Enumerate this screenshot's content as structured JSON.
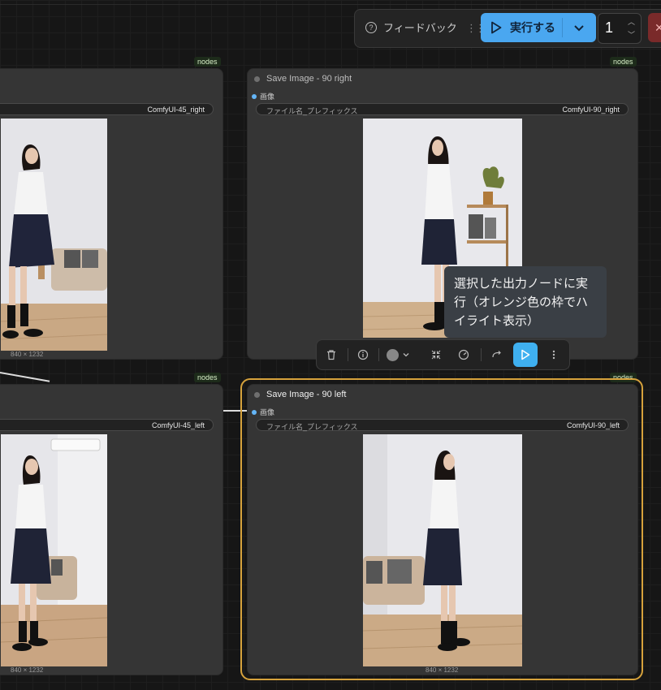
{
  "toolbar": {
    "feedback_label": "フィードバック",
    "run_label": "実行する",
    "batch_count": "1",
    "run_color": "#4aa7f0"
  },
  "nodes": [
    {
      "badge": "nodes",
      "title": "",
      "input_label": "",
      "prefix_label": "",
      "prefix_value": "ComfyUI-45_right",
      "dims": "840 × 1232"
    },
    {
      "badge": "nodes",
      "title": "Save Image - 90 right",
      "input_label": "画像",
      "prefix_label": "ファイル名_プレフィックス",
      "prefix_value": "ComfyUI-90_right",
      "dims": ""
    },
    {
      "badge": "nodes",
      "title": "",
      "input_label": "",
      "prefix_label": "",
      "prefix_value": "ComfyUI-45_left",
      "dims": "840 × 1232"
    },
    {
      "badge": "nodes",
      "title": "Save Image - 90 left",
      "input_label": "画像",
      "prefix_label": "ファイル名_プレフィックス",
      "prefix_value": "ComfyUI-90_left",
      "dims": "840 × 1232"
    }
  ],
  "tooltip": {
    "text": "選択した出力ノードに実行（オレンジ色の枠でハイライト表示）"
  },
  "selection_toolbox": {
    "items": [
      "trash-icon",
      "info-icon",
      "color-picker",
      "fit-icon",
      "bypass-icon",
      "redo-icon",
      "run-icon",
      "more-icon"
    ],
    "selected_color": "#d6a23c"
  }
}
